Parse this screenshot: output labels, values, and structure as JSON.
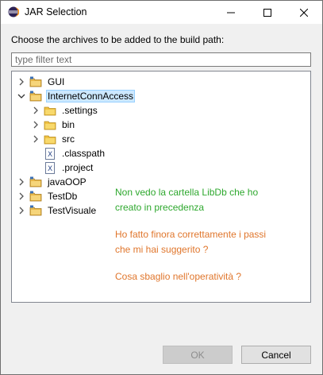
{
  "window": {
    "title": "JAR Selection"
  },
  "dialog": {
    "prompt": "Choose the archives to be added to the build path:",
    "filter_placeholder": "type filter text"
  },
  "tree": {
    "items": [
      {
        "label": "GUI",
        "expanded": false,
        "type": "project"
      },
      {
        "label": "InternetConnAccess",
        "expanded": true,
        "type": "project",
        "selected": true
      },
      {
        "label": ".settings",
        "expanded": false,
        "type": "folder"
      },
      {
        "label": "bin",
        "expanded": false,
        "type": "folder"
      },
      {
        "label": "src",
        "expanded": false,
        "type": "folder"
      },
      {
        "label": ".classpath",
        "type": "file"
      },
      {
        "label": ".project",
        "type": "file"
      },
      {
        "label": "javaOOP",
        "expanded": false,
        "type": "project"
      },
      {
        "label": "TestDb",
        "expanded": false,
        "type": "project"
      },
      {
        "label": "TestVisuale",
        "expanded": false,
        "type": "project"
      }
    ]
  },
  "annotations": {
    "line1": "Non vedo la cartella LibDb che ho",
    "line2": "creato in precedenza",
    "line3": "Ho fatto finora correttamente i passi",
    "line4": "che mi hai suggerito ?",
    "line5": "Cosa sbaglio nell'operatività ?",
    "colors": {
      "green": "#2ea82e",
      "orange": "#e0762c"
    }
  },
  "buttons": {
    "ok_label": "OK",
    "cancel_label": "Cancel"
  },
  "colors": {
    "selection": "#cce8ff",
    "folder": "#f0c244",
    "project_folder": "#e8b84a"
  }
}
